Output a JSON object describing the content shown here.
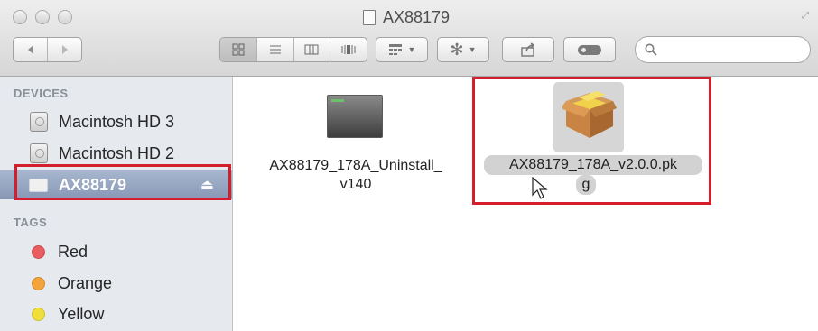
{
  "window": {
    "title": "AX88179",
    "traffic_lights": [
      "close",
      "minimize",
      "zoom"
    ]
  },
  "toolbar": {
    "back_icon": "chevron-left-icon",
    "forward_icon": "chevron-right-icon",
    "view_buttons": [
      "icon-view",
      "list-view",
      "column-view",
      "cover-flow-view"
    ],
    "arrange_icon": "arrange-grid-icon",
    "action_icon": "gear-icon",
    "share_icon": "share-icon",
    "tags_icon": "tag-icon",
    "search_placeholder": ""
  },
  "sidebar": {
    "devices_header": "DEVICES",
    "devices": [
      {
        "label": "Macintosh HD 3",
        "icon": "hard-drive-icon"
      },
      {
        "label": "Macintosh HD 2",
        "icon": "hard-drive-icon"
      },
      {
        "label": "AX88179",
        "icon": "external-drive-icon",
        "selected": true
      }
    ],
    "tags_header": "TAGS",
    "tags": [
      {
        "label": "Red",
        "color": "#e95d5f"
      },
      {
        "label": "Orange",
        "color": "#f5a43b"
      },
      {
        "label": "Yellow",
        "color": "#f0df3a"
      }
    ]
  },
  "files": [
    {
      "name_line1": "AX88179_178A_Uninstall_",
      "name_line2": "v140",
      "icon": "application-icon"
    },
    {
      "name_line1": "AX88179_178A_v2.0.0.pk",
      "name_line2": "g",
      "icon": "package-icon",
      "selected": true
    }
  ],
  "colors": {
    "highlight_box": "#d51e2b",
    "sidebar_bg": "#e6e9ee",
    "sidebar_selected": "#8e9eb9"
  }
}
